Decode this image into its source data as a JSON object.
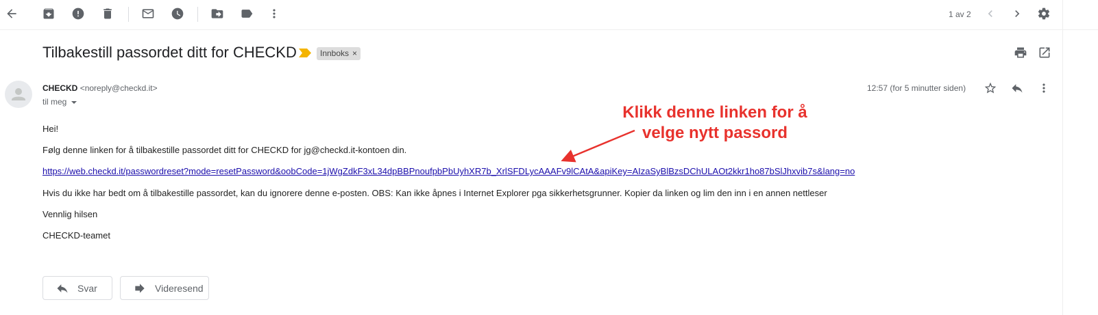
{
  "toolbar": {
    "icons": [
      "back-arrow-icon",
      "archive-icon",
      "report-spam-icon",
      "delete-icon",
      "mark-unread-icon",
      "snooze-icon",
      "move-to-icon",
      "label-icon",
      "more-vert-icon"
    ],
    "pager": "1 av 2",
    "right_icons": [
      "chevron-left-icon",
      "chevron-right-icon",
      "settings-gear-icon"
    ]
  },
  "email": {
    "subject": "Tilbakestill passordet ditt for CHECKD",
    "label": "Innboks",
    "label_close": "×",
    "sender_name": "CHECKD",
    "sender_email": "<noreply@checkd.it>",
    "recipient": "til meg",
    "timestamp": "12:57 (for 5 minutter siden)",
    "body": {
      "greeting": "Hei!",
      "instruction": "Følg denne linken for å tilbakestille passordet ditt for CHECKD for jg@checkd.it-kontoen din.",
      "link": "https://web.checkd.it/passwordreset?mode=resetPassword&oobCode=1jWgZdkF3xL34dpBBPnoufpbPbUyhXR7b_XrlSFDLycAAAFv9lCAtA&apiKey=AIzaSyBlBzsDChULAOt2kkr1ho87bSlJhxvib7s&lang=no",
      "notice": "Hvis du ikke har bedt om å tilbakestille passordet, kan du ignorere denne e-posten. OBS: Kan ikke åpnes i Internet Explorer pga sikkerhetsgrunner. Kopier da linken og lim den inn i en annen nettleser",
      "closing": "Vennlig hilsen",
      "signature": "CHECKD-teamet"
    }
  },
  "annotation": {
    "line1": "Klikk denne linken for å",
    "line2": "velge nytt passord",
    "color": "#e8322d"
  },
  "actions": {
    "reply_label": "Svar",
    "forward_label": "Videresend"
  },
  "colors": {
    "link": "#1a0dab",
    "importance_marker": "#f4b400",
    "icon_gray": "#5f6368"
  }
}
